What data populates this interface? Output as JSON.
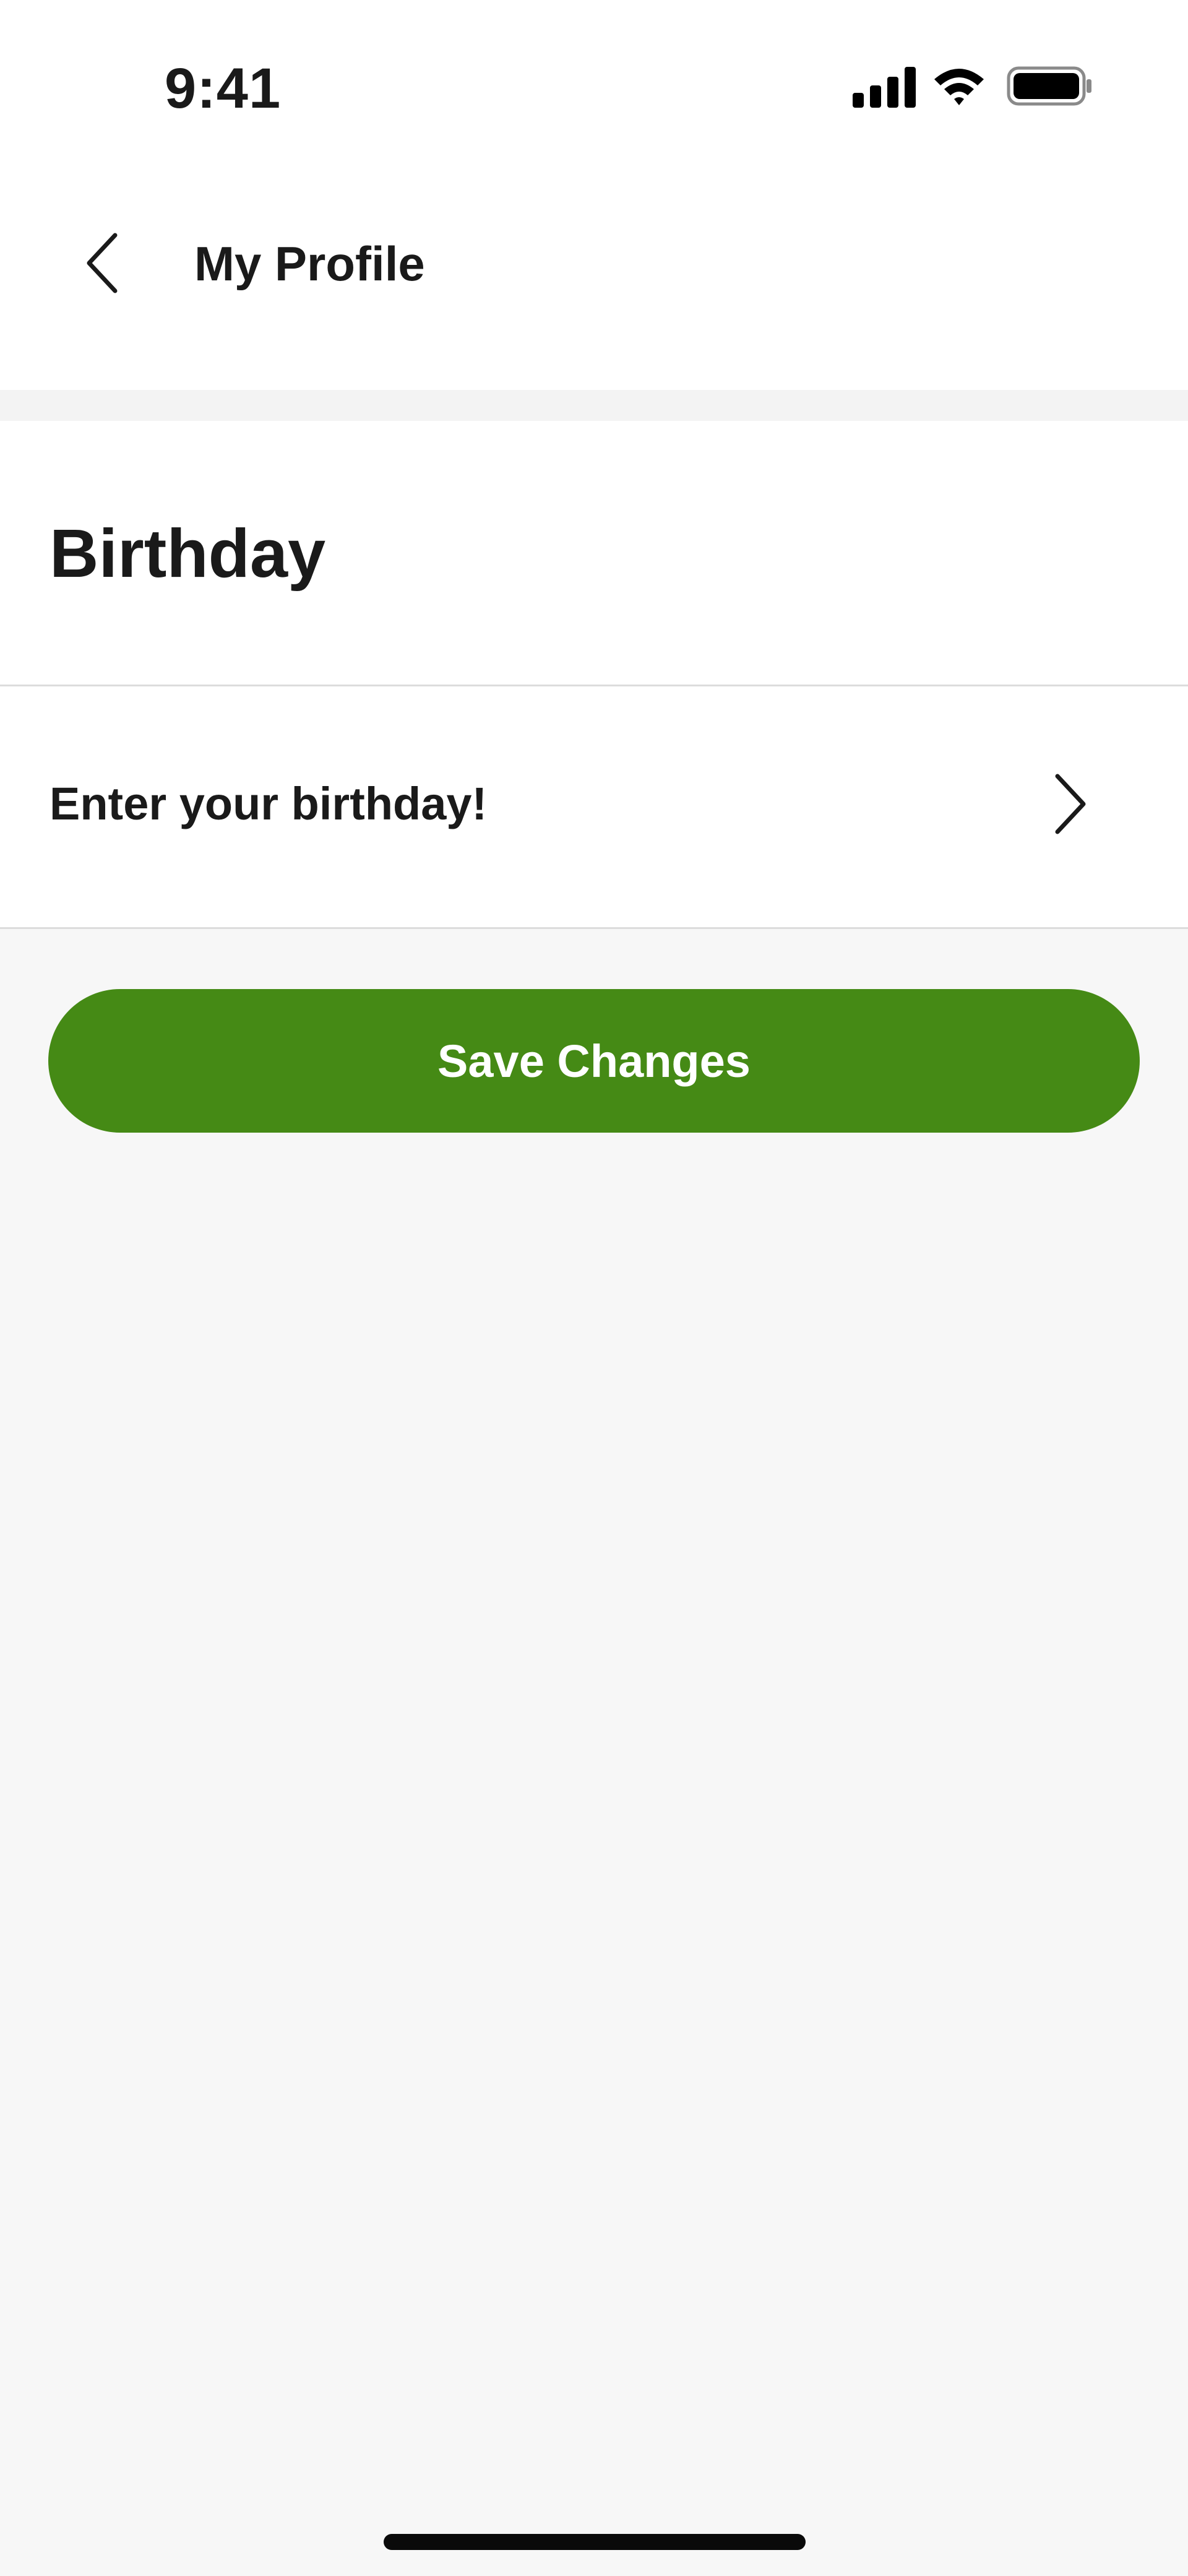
{
  "status_bar": {
    "time": "9:41"
  },
  "header": {
    "title": "My Profile"
  },
  "section": {
    "title": "Birthday",
    "row_label": "Enter your birthday!"
  },
  "actions": {
    "save_label": "Save Changes"
  },
  "colors": {
    "accent": "#458a15",
    "page_background": "#f7f7f7",
    "surface": "#ffffff",
    "text": "#1a1a1a",
    "divider": "#dcdcdc"
  },
  "icons": {
    "back": "chevron-left-icon",
    "row": "chevron-right-icon",
    "signal": "cellular-signal-icon",
    "wifi": "wifi-icon",
    "battery": "battery-icon"
  }
}
